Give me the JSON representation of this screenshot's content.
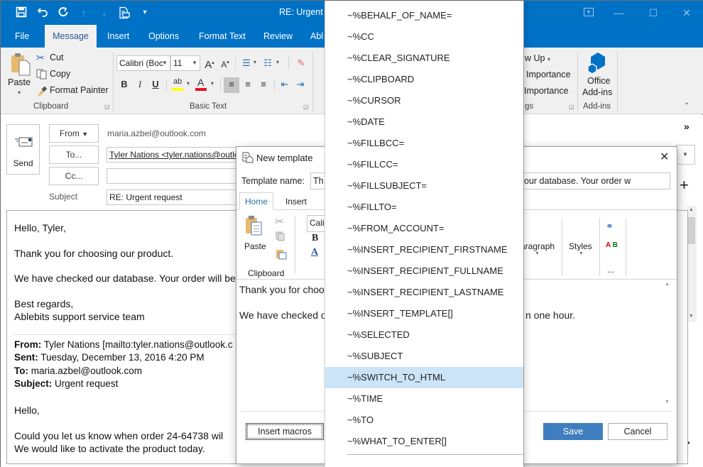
{
  "window": {
    "title": "RE: Urgent r",
    "quick_access": [
      "save-icon",
      "undo-icon",
      "redo-icon",
      "up-arrow-icon",
      "down-arrow-icon",
      "template-icon",
      "customize-icon"
    ]
  },
  "tabs": [
    {
      "label": "File",
      "active": false
    },
    {
      "label": "Message",
      "active": true
    },
    {
      "label": "Insert",
      "active": false
    },
    {
      "label": "Options",
      "active": false
    },
    {
      "label": "Format Text",
      "active": false
    },
    {
      "label": "Review",
      "active": false
    },
    {
      "label": "Abl",
      "active": false
    }
  ],
  "ribbon": {
    "clipboard": {
      "paste": "Paste",
      "cut": "Cut",
      "copy": "Copy",
      "format_painter": "Format Painter",
      "group_label": "Clipboard"
    },
    "basic_text": {
      "font": "Calibri (Boc",
      "size": "11",
      "bold": "B",
      "italic": "I",
      "underline": "U",
      "group_label": "Basic Text",
      "highlight_color": "#ffff00",
      "font_color": "#e81123"
    },
    "tags": {
      "follow_up": "w Up",
      "high_importance": "Importance",
      "low_importance": "Importance",
      "group_label": "gs"
    },
    "addins": {
      "office_addins_line1": "Office",
      "office_addins_line2": "Add-ins",
      "group_label": "Add-ins"
    }
  },
  "compose": {
    "send": "Send",
    "from_button": "From",
    "from_value": "maria.azbel@outlook.com",
    "to_button": "To...",
    "to_value": "Tyler Nations <tyler.nations@outlook",
    "cc_button": "Cc...",
    "cc_value": "",
    "subject_label": "Subject",
    "subject_value": "RE: Urgent request",
    "body": {
      "greeting": "Hello, Tyler,",
      "line1": "Thank you for choosing our product.",
      "line2": "We have checked our database. Your order will be p",
      "closing1": "Best regards,",
      "closing2": "Ablebits support service team",
      "quoted": {
        "from_label": "From:",
        "from_value": " Tyler Nations [mailto:tyler.nations@outlook.c",
        "sent_label": "Sent:",
        "sent_value": " Tuesday, December 13, 2016 4:20 PM",
        "to_label": "To:",
        "to_value": " maria.azbel@outlook.com",
        "subject_label": "Subject:",
        "subject_value": " Urgent request",
        "hello": "Hello,",
        "line1": "Could you let us know when order 24-64738 wil",
        "line2": "We would like to activate the product today."
      }
    }
  },
  "dialog": {
    "title": "New template",
    "template_name_label": "Template name:",
    "template_name_left": "Th",
    "template_name_right": "our database. Your order w",
    "tabs": [
      {
        "label": "Home",
        "active": true
      },
      {
        "label": "Insert",
        "active": false
      }
    ],
    "paste": "Paste",
    "clipboard_label": "Clipboard",
    "font": "Calil",
    "paragraph_label": "aragraph",
    "styles_label": "Styles",
    "more": "...",
    "body_line1": "Thank you for choos",
    "body_line2_left": "We have checked o",
    "body_line2_right": "n one hour.",
    "insert_macros": "Insert macros",
    "save": "Save",
    "cancel": "Cancel",
    "accent_color": "#3e7ebf"
  },
  "macro_menu": {
    "items": [
      "~%BEHALF_OF_NAME=",
      "~%CC",
      "~%CLEAR_SIGNATURE",
      "~%CLIPBOARD",
      "~%CURSOR",
      "~%DATE",
      "~%FILLBCC=",
      "~%FILLCC=",
      "~%FILLSUBJECT=",
      "~%FILLTO=",
      "~%FROM_ACCOUNT=",
      "~%INSERT_RECIPIENT_FIRSTNAME",
      "~%INSERT_RECIPIENT_FULLNAME",
      "~%INSERT_RECIPIENT_LASTNAME",
      "~%INSERT_TEMPLATE[]",
      "~%SELECTED",
      "~%SUBJECT",
      "~%SWITCH_TO_HTML",
      "~%TIME",
      "~%TO",
      "~%WHAT_TO_ENTER[]"
    ],
    "selected_index": 17
  }
}
